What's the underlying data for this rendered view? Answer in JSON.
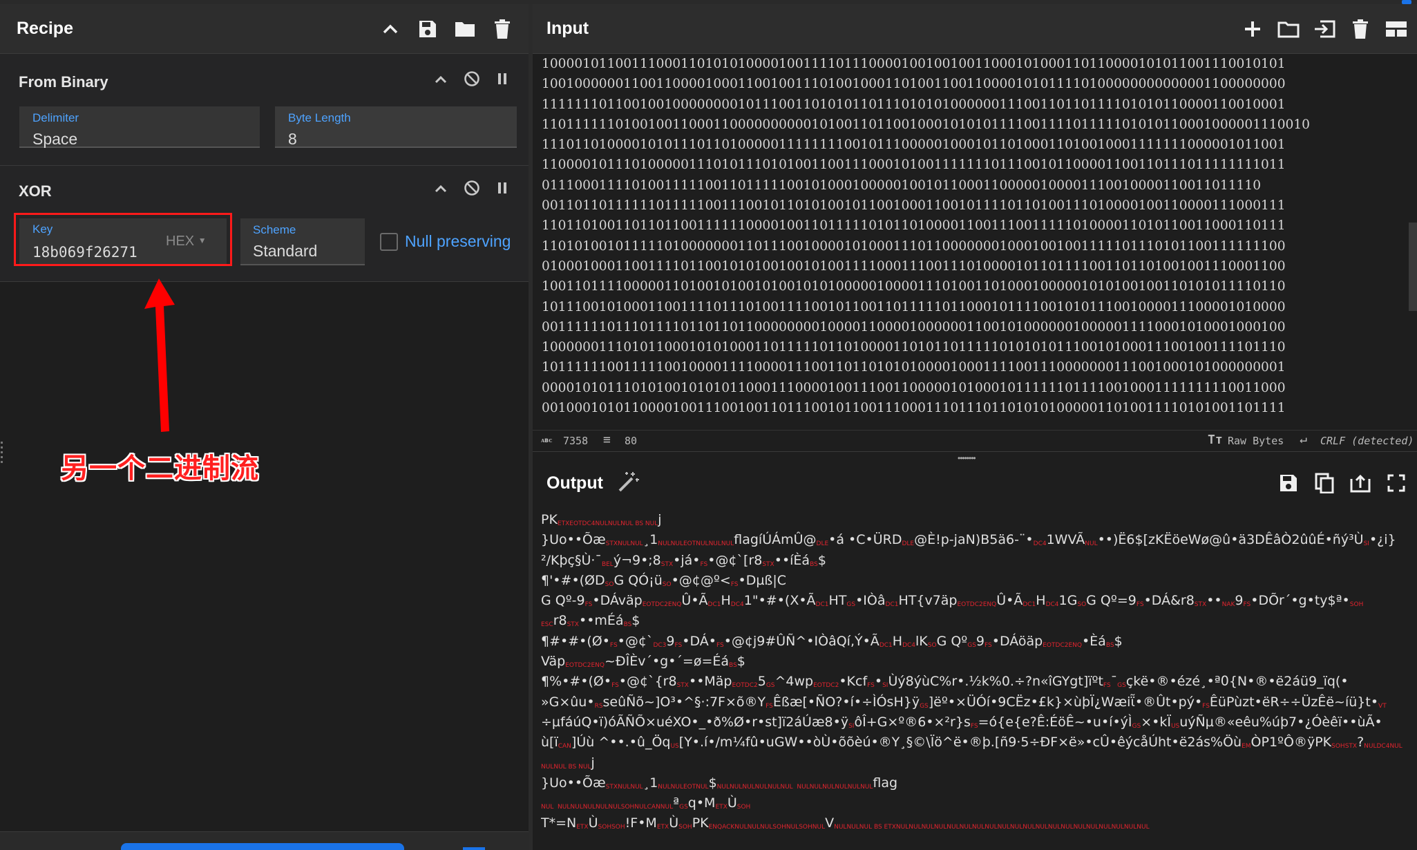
{
  "recipe": {
    "title": "Recipe",
    "icons": [
      "chevron-up-icon",
      "save-icon",
      "folder-icon",
      "trash-icon"
    ],
    "operations": [
      {
        "name": "From Binary",
        "fields": {
          "delimiter": {
            "label": "Delimiter",
            "value": "Space"
          },
          "byte_length": {
            "label": "Byte Length",
            "value": "8"
          }
        }
      },
      {
        "name": "XOR",
        "fields": {
          "key": {
            "label": "Key",
            "value": "18b069f26271",
            "format": "HEX"
          },
          "scheme": {
            "label": "Scheme",
            "value": "Standard"
          },
          "null_preserving": {
            "label": "Null preserving",
            "checked": false
          }
        }
      }
    ]
  },
  "annotation": {
    "text": "另一个二进制流",
    "color": "#ff1a1a"
  },
  "input": {
    "title": "Input",
    "lines": [
      "1000010110011100011010101000010011110111000010010010011000101000110110000101011001110010101",
      "1001000000110011000010001100100111010010001101001100110000101011110100000000000001100000000",
      "1111111011001001000000001011100110101011011101010100000011100110110111101010110000110010001",
      "1101111110100100110001100000000001010011011001000101010111100111101111101010110001000001110010",
      "1110110100001010111011010000011111111001011100000100010110100011010010001111111000001011001",
      "1100001011101000001110101110101001100111000101001111111011100101100001100110111011111111011",
      "0111000111101001111100110111110010100010000010010110001100000100001110010000110011011110",
      "0011011011111101111100111001011010100101100100011001011110110100111010000100110000111000111",
      "1101101001101101100111111000010011011111010110100001100111001111101000011010110011000110111",
      "1101010010111110100000001101110010000101000111011000000010001001001111101110101100111111100",
      "0100010001100111101100101010010010100111100011100111010000101101111001101101001001110001100",
      "1001101111000001101001010010100101010000010000111010011010001000001010100100110101011110110",
      "1011100101000110011110111010011110010110011011111011000101111001010111001000011100001010000",
      "0011111101110111101101101100000000100001100001000000110010100000010000011110001010001000100",
      "1000000111010110001010100011011111011010000110101101111101010101110010100011100100111101110",
      "1011111100111110010000111100001110011011010101000010001111001110000000111001000101000000001",
      "0000101011101010010101011000111000010011100110000010100010111111011110010001111111110011000",
      "0010001010110000100111001001101110010110011100011101110110101010000011010011110101001101111"
    ],
    "status": {
      "chars_icon": "abc-icon",
      "chars": "7358",
      "lines_icon": "lines-icon",
      "lines": "80",
      "raw_bytes": "Raw Bytes",
      "eol": "CRLF (detected)"
    },
    "icons": [
      "plus-icon",
      "folder-icon",
      "import-icon",
      "trash-icon",
      "layout-icon"
    ]
  },
  "output": {
    "title": "Output",
    "icons": [
      "magic-wand-icon",
      "save-icon",
      "copy-icon",
      "replace-input-icon",
      "maximize-icon"
    ],
    "lines": [
      [
        [
          "t",
          "PK"
        ],
        [
          "c",
          "ETXEOTDC4NULNULNUL BS NUL"
        ],
        [
          "t",
          "j"
        ]
      ],
      [
        [
          "t",
          "}Uo••Õæ"
        ],
        [
          "c",
          "STXNULNUL"
        ],
        [
          "t",
          "¸1"
        ],
        [
          "c",
          "NULNULEOTNULNULNUL"
        ],
        [
          "t",
          "flagíÚÁmÛ@"
        ],
        [
          "c",
          "DLE"
        ],
        [
          "t",
          "•á •C•ÜRD"
        ],
        [
          "c",
          "DLE"
        ],
        [
          "t",
          "@È!p-jaN)B5ä6-¨•"
        ],
        [
          "c",
          "DC4"
        ],
        [
          "t",
          "1WVÃ"
        ],
        [
          "c",
          "NUL"
        ],
        [
          "t",
          "••)Ë6$[zKËöeWø@û•ä3DÊâÒ2ûûÉ•ñý³Ù"
        ],
        [
          "c",
          "SI"
        ],
        [
          "t",
          "•¿i}"
        ]
      ],
      [
        [
          "t",
          "²/Kþç§Ù·¯"
        ],
        [
          "c",
          "BEL"
        ],
        [
          "t",
          "ý¬9•;8"
        ],
        [
          "c",
          "STX"
        ],
        [
          "t",
          "•já•"
        ],
        [
          "c",
          "FS"
        ],
        [
          "t",
          "•@¢`[r8"
        ],
        [
          "c",
          "STX"
        ],
        [
          "t",
          "••íÈá"
        ],
        [
          "c",
          "BS"
        ],
        [
          "t",
          "$"
        ]
      ],
      [
        [
          "t",
          "¶'•#•(ØD"
        ],
        [
          "c",
          "SO"
        ],
        [
          "t",
          "G QÓ¡ü"
        ],
        [
          "c",
          "SO"
        ],
        [
          "t",
          "•@¢@º<"
        ],
        [
          "c",
          "FS"
        ],
        [
          "t",
          "•Dµß|C"
        ]
      ],
      [
        [
          "t",
          "G Qº-9"
        ],
        [
          "c",
          "FS"
        ],
        [
          "t",
          "•DÁväp"
        ],
        [
          "c",
          "EOTDC2ENQ"
        ],
        [
          "t",
          "Û•Ã"
        ],
        [
          "c",
          "DC1"
        ],
        [
          "t",
          "H"
        ],
        [
          "c",
          "DC4"
        ],
        [
          "t",
          "1\"•#•(X•Ã"
        ],
        [
          "c",
          "DC1"
        ],
        [
          "t",
          "HT"
        ],
        [
          "c",
          "GS"
        ],
        [
          "t",
          "•IÒâ"
        ],
        [
          "c",
          "DC1"
        ],
        [
          "t",
          "HT{v7äp"
        ],
        [
          "c",
          "EOTDC2ENQ"
        ],
        [
          "t",
          "Û•Ã"
        ],
        [
          "c",
          "DC1"
        ],
        [
          "t",
          "H"
        ],
        [
          "c",
          "DC4"
        ],
        [
          "t",
          "1G"
        ],
        [
          "c",
          "SO"
        ],
        [
          "t",
          "G Qº=9"
        ],
        [
          "c",
          "FS"
        ],
        [
          "t",
          "•DÁ&r8"
        ],
        [
          "c",
          "STX"
        ],
        [
          "t",
          "••"
        ],
        [
          "c",
          "NAK"
        ],
        [
          "t",
          "9"
        ],
        [
          "c",
          "FS"
        ],
        [
          "t",
          "•DÕr´•g•ty$ª•"
        ],
        [
          "c",
          "SOH"
        ]
      ],
      [
        [
          "c",
          "ESC"
        ],
        [
          "t",
          "r8"
        ],
        [
          "c",
          "STX"
        ],
        [
          "t",
          "••mÉá"
        ],
        [
          "c",
          "BS"
        ],
        [
          "t",
          "$"
        ]
      ],
      [
        [
          "t",
          "¶#•#•(Ø•"
        ],
        [
          "c",
          "FS"
        ],
        [
          "t",
          "•@¢`"
        ],
        [
          "c",
          "DC3"
        ],
        [
          "t",
          "9"
        ],
        [
          "c",
          "FS"
        ],
        [
          "t",
          "•DÁ•"
        ],
        [
          "c",
          "FS"
        ],
        [
          "t",
          "•@¢j9#ÛÑ^•IÒâQí,Ý•Ã"
        ],
        [
          "c",
          "DC1"
        ],
        [
          "t",
          "H"
        ],
        [
          "c",
          "DC4"
        ],
        [
          "t",
          "lK"
        ],
        [
          "c",
          "SO"
        ],
        [
          "t",
          "G Qº"
        ],
        [
          "c",
          "GS"
        ],
        [
          "t",
          "9"
        ],
        [
          "c",
          "FS"
        ],
        [
          "t",
          "•DÁöäp"
        ],
        [
          "c",
          "EOTDC2ENQ"
        ],
        [
          "t",
          "•Èá"
        ],
        [
          "c",
          "BS"
        ],
        [
          "t",
          "$"
        ]
      ],
      [
        [
          "t",
          "Väp"
        ],
        [
          "c",
          "EOTDC2ENQ"
        ],
        [
          "t",
          "~ÐÎÈv´•g•´=ø=Éá"
        ],
        [
          "c",
          "BS"
        ],
        [
          "t",
          "$"
        ]
      ],
      [
        [
          "t",
          "¶%•#•(Ø•"
        ],
        [
          "c",
          "FS"
        ],
        [
          "t",
          "•@¢`{r8"
        ],
        [
          "c",
          "STX"
        ],
        [
          "t",
          "••Mäp"
        ],
        [
          "c",
          "EOTDC2"
        ],
        [
          "t",
          "5"
        ],
        [
          "c",
          "GS"
        ],
        [
          "t",
          "^4wp"
        ],
        [
          "c",
          "EOTDC2"
        ],
        [
          "t",
          "•Kcf"
        ],
        [
          "c",
          "FS"
        ],
        [
          "t",
          "•"
        ],
        [
          "c",
          "SI"
        ],
        [
          "t",
          "Ùý8ýùC%r•.½k%0.÷?n«îGYgt]ïºt"
        ],
        [
          "c",
          "FS"
        ],
        [
          "t",
          "¯"
        ],
        [
          "c",
          "GS"
        ],
        [
          "t",
          "çkë•®•ézé¸•ª߀{N•®•ë2áü9_ïq(•"
        ]
      ],
      [
        [
          "t",
          "»G×ûu•"
        ],
        [
          "c",
          "RS"
        ],
        [
          "t",
          "seûÑõ~]O³•^§·:7F×õ®Y"
        ],
        [
          "c",
          "FS"
        ],
        [
          "t",
          "Êßæ[•ÑO?•í•÷ÌÓsH}ÿ"
        ],
        [
          "c",
          "GS"
        ],
        [
          "t",
          "]ëº•×ÜÓí•9CËz•£k}×ùþÏ¿Wæiῗ•®Ût•pý•"
        ],
        [
          "c",
          "FS"
        ],
        [
          "t",
          "ÊüPùzt•ëR÷÷ÜzÊë~íü}t•"
        ],
        [
          "c",
          "VT"
        ]
      ],
      [
        [
          "t",
          "÷µfáúQ•ï)óÃÑÕ×uéXO•_•ð%Ø•r•st]ï2áÚæ8•ÿ"
        ],
        [
          "c",
          "SI"
        ],
        [
          "t",
          "ôÎ+G×º®6•×²r}s"
        ],
        [
          "c",
          "FS"
        ],
        [
          "t",
          "=ó{e{e?Ê:ÉöÊ~•u•í•ýÌ"
        ],
        [
          "c",
          "GS"
        ],
        [
          "t",
          "×•kÏ"
        ],
        [
          "c",
          "US"
        ],
        [
          "t",
          "uýÑµ®«eêu%úþ7•¿Óèêï••ùÃ•"
        ]
      ],
      [
        [
          "t",
          "ù[ï"
        ],
        [
          "c",
          "CAN"
        ],
        [
          "t",
          "]Úù ^••.•û_Öq"
        ],
        [
          "c",
          "US"
        ],
        [
          "t",
          "[Y•.í•/m¼fû•uGW••òÙ•õõèú•®Y¸§©\\Ïö^ë•®þ.[ñ9·5÷ÐF×ë»•cÛ•êýcåÚht•ë2ás%Öù"
        ],
        [
          "c",
          "EM"
        ],
        [
          "t",
          "ÒP1ºÔ®ÿPK"
        ],
        [
          "c",
          "SOHSTX"
        ],
        [
          "t",
          "?"
        ],
        [
          "c",
          "NULDC4NUL"
        ]
      ],
      [
        [
          "c",
          "NULNUL BS NUL"
        ],
        [
          "t",
          "j"
        ]
      ],
      [
        [
          "t",
          "}Uo••Õæ"
        ],
        [
          "c",
          "STXNULNUL"
        ],
        [
          "t",
          "¸1"
        ],
        [
          "c",
          "NULNULEOTNUL"
        ],
        [
          "t",
          "$"
        ],
        [
          "c",
          "NULNULNULNULNULNUL  NULNULNULNULNULNUL"
        ],
        [
          "t",
          "flag"
        ]
      ],
      [
        [
          "c",
          "NUL  NULNULNULNULNULSOHNULCANNUL"
        ],
        [
          "t",
          "ª"
        ],
        [
          "c",
          "GS"
        ],
        [
          "t",
          "q•M"
        ],
        [
          "c",
          "ETX"
        ],
        [
          "t",
          "Ù"
        ],
        [
          "c",
          "SOH"
        ]
      ],
      [
        [
          "t",
          "T*=N"
        ],
        [
          "c",
          "ETX"
        ],
        [
          "t",
          "Ù"
        ],
        [
          "c",
          "SOHSOH"
        ],
        [
          "t",
          "!F•M"
        ],
        [
          "c",
          "ETX"
        ],
        [
          "t",
          "Ù"
        ],
        [
          "c",
          "SOH"
        ],
        [
          "t",
          "PK"
        ],
        [
          "c",
          "ENQACKNULNULNULSOHNULSOHNUL"
        ],
        [
          "t",
          "V"
        ],
        [
          "c",
          "NULNULNUL BS ETXNULNULNULNULNULNULNULNULNULNULNULNULNULNULNULNULNULNULNULNUL"
        ]
      ]
    ]
  }
}
